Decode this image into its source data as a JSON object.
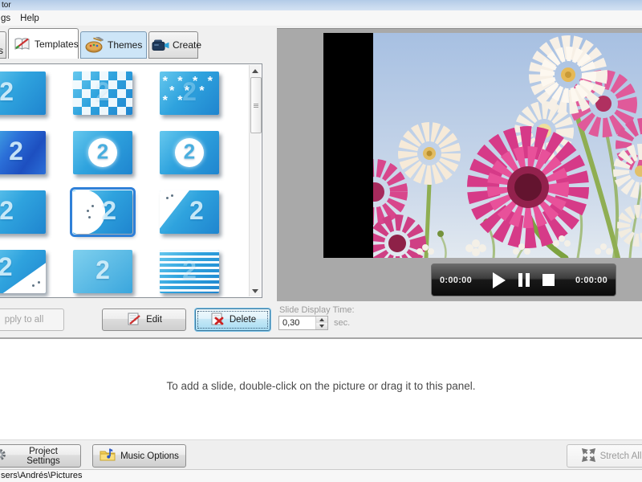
{
  "window": {
    "title": "tor"
  },
  "menu": {
    "items": [
      "gs",
      "Help"
    ]
  },
  "tabs": {
    "partial_label": "s",
    "items": [
      {
        "label": "Templates",
        "icon": "book-pencil-icon",
        "state": "active"
      },
      {
        "label": "Themes",
        "icon": "palette-icon",
        "state": "highlighted"
      },
      {
        "label": "Create",
        "icon": "video-camera-icon",
        "state": "normal"
      }
    ]
  },
  "templates": {
    "apply_all_label": "pply to all",
    "edit_label": "Edit",
    "delete_label": "Delete",
    "selected_index": 7,
    "items": [
      {
        "variant": "plain-left",
        "number": "2"
      },
      {
        "variant": "checker",
        "number": "2"
      },
      {
        "variant": "puzzle",
        "number": "2"
      },
      {
        "variant": "dark",
        "number": "2"
      },
      {
        "variant": "circle",
        "number": "2"
      },
      {
        "variant": "circle",
        "number": "2"
      },
      {
        "variant": "plain-left",
        "number": "2"
      },
      {
        "variant": "circle-wipe",
        "number": "2"
      },
      {
        "variant": "diag-tl",
        "number": "2"
      },
      {
        "variant": "diag-br",
        "number": "2"
      },
      {
        "variant": "plain-soft",
        "number": "2"
      },
      {
        "variant": "stripes",
        "number": "2"
      }
    ]
  },
  "preview": {
    "elapsed_time": "0:00:00",
    "total_time": "0:00:00",
    "slide_display_time_label": "Slide Display Time:",
    "slide_display_time_value": "0,30",
    "slide_display_time_unit": "sec."
  },
  "slides_panel": {
    "hint": "To add a slide, double-click on the picture or drag it to this panel."
  },
  "footer": {
    "project_settings_label": "Project Settings",
    "music_options_label": "Music Options",
    "stretch_all_label": "Stretch All"
  },
  "status_bar": {
    "path": "sers\\Andrés\\Pictures"
  },
  "icons": {
    "templates_tab": "book-pencil-icon",
    "themes_tab": "palette-icon",
    "create_tab": "video-camera-icon",
    "edit_button": "notepad-pencil-icon",
    "delete_button": "notepad-x-icon",
    "project_settings": "gear-icon",
    "music_options": "folder-note-icon",
    "stretch_all": "expand-arrows-icon"
  },
  "colors": {
    "selection_blue": "#2f80d8",
    "thumbnail_blue": "#2d9fe0",
    "themes_tab_highlight": "#cde5f7",
    "preview_background": "#a9a9a9",
    "player_bar": "#1c1c1c",
    "titlebar_blue": "#bed5ec"
  }
}
